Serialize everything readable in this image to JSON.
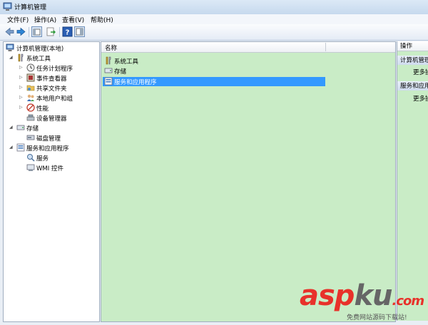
{
  "window": {
    "title": "计算机管理"
  },
  "menu": [
    "文件(F)",
    "操作(A)",
    "查看(V)",
    "帮助(H)"
  ],
  "toolbar": {
    "buttons": [
      "back-icon",
      "forward-icon",
      "console-tree-icon",
      "export-icon",
      "help-icon",
      "properties-icon"
    ]
  },
  "tree": {
    "root": "计算机管理(本地)",
    "items": [
      {
        "label": "系统工具",
        "level": 1,
        "expanded": true
      },
      {
        "label": "任务计划程序",
        "level": 2
      },
      {
        "label": "事件查看器",
        "level": 2
      },
      {
        "label": "共享文件夹",
        "level": 2
      },
      {
        "label": "本地用户和组",
        "level": 2
      },
      {
        "label": "性能",
        "level": 2
      },
      {
        "label": "设备管理器",
        "level": 2
      },
      {
        "label": "存储",
        "level": 1,
        "expanded": true
      },
      {
        "label": "磁盘管理",
        "level": 2
      },
      {
        "label": "服务和应用程序",
        "level": 1,
        "expanded": true
      },
      {
        "label": "服务",
        "level": 2
      },
      {
        "label": "WMI 控件",
        "level": 2
      }
    ]
  },
  "list": {
    "column": "名称",
    "rows": [
      {
        "label": "系统工具",
        "selected": false
      },
      {
        "label": "存储",
        "selected": false
      },
      {
        "label": "服务和应用程序",
        "selected": true
      }
    ]
  },
  "actions": {
    "title": "操作",
    "sections": [
      {
        "header": "计算机管理",
        "link": "更多操作"
      },
      {
        "header": "服务和应用程序",
        "link": "更多操作"
      }
    ]
  },
  "watermark": {
    "logo_a": "asp",
    "logo_b": "ku",
    "logo_c": ".com",
    "text": "免费网站源码下载站!"
  }
}
